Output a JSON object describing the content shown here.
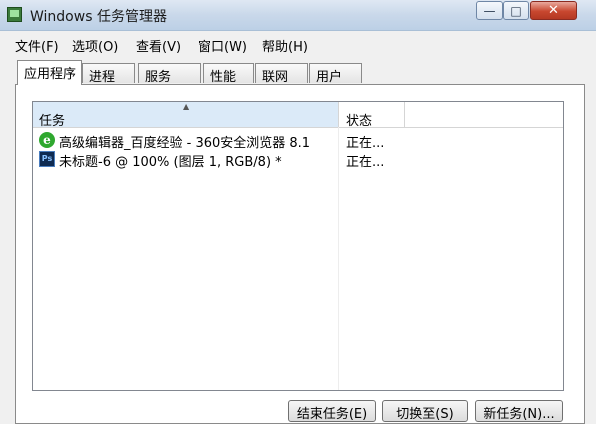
{
  "window": {
    "title": "Windows 任务管理器",
    "btn_minimize": "—",
    "btn_maximize": "□",
    "btn_close": "✕"
  },
  "menu": [
    {
      "label": "文件(F)"
    },
    {
      "label": "选项(O)"
    },
    {
      "label": "查看(V)"
    },
    {
      "label": "窗口(W)"
    },
    {
      "label": "帮助(H)"
    }
  ],
  "tabs": [
    {
      "label": "应用程序",
      "active": true
    },
    {
      "label": "进程",
      "active": false
    },
    {
      "label": "服务",
      "active": false
    },
    {
      "label": "性能",
      "active": false
    },
    {
      "label": "联网",
      "active": false
    },
    {
      "label": "用户",
      "active": false
    }
  ],
  "list": {
    "sort_indicator": "▲",
    "columns": {
      "task": "任务",
      "status": "状态"
    },
    "rows": [
      {
        "icon": "ie-icon",
        "icon_glyph": "e",
        "name": "高级编辑器_百度经验 - 360安全浏览器 8.1",
        "status": "正在..."
      },
      {
        "icon": "photoshop-icon",
        "icon_glyph": "Ps",
        "name": "未标题-6 @ 100% (图层 1, RGB/8) *",
        "status": "正在..."
      }
    ]
  },
  "buttons": {
    "end_task": "结束任务(E)",
    "switch_to": "切换至(S)",
    "new_task": "新任务(N)..."
  }
}
